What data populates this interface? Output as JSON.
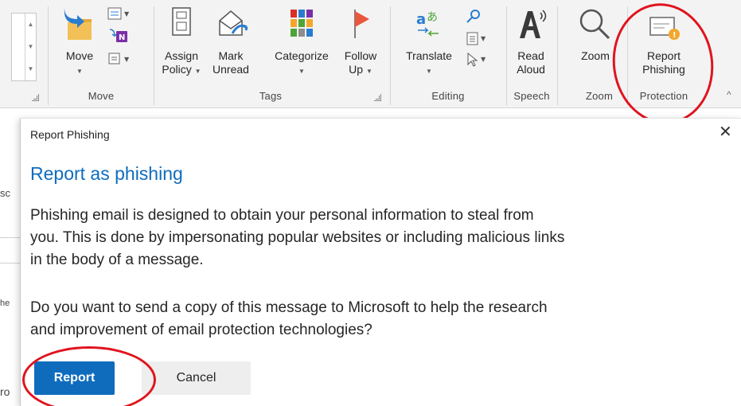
{
  "ribbon": {
    "move_group": {
      "move_label": "Move",
      "group_label": "Move"
    },
    "tags_group": {
      "assign_policy_line1": "Assign",
      "assign_policy_line2": "Policy",
      "mark_unread_line1": "Mark",
      "mark_unread_line2": "Unread",
      "categorize_label": "Categorize",
      "follow_up_line1": "Follow",
      "follow_up_line2": "Up",
      "group_label": "Tags"
    },
    "editing_group": {
      "translate_label": "Translate",
      "group_label": "Editing"
    },
    "speech_group": {
      "read_aloud_line1": "Read",
      "read_aloud_line2": "Aloud",
      "group_label": "Speech"
    },
    "zoom_group": {
      "zoom_label": "Zoom",
      "group_label": "Zoom"
    },
    "protection_group": {
      "report_phishing_line1": "Report",
      "report_phishing_line2": "Phishing",
      "group_label": "Protection"
    }
  },
  "background": {
    "frag1": "sc",
    "frag2": "he",
    "frag3": "ro"
  },
  "dialog": {
    "title": "Report Phishing",
    "close_glyph": "✕",
    "heading": "Report as phishing",
    "body_paragraph1_line1": "Phishing email is designed to obtain your personal information to steal from",
    "body_paragraph1_line2": "you. This is done by impersonating popular websites or including malicious links",
    "body_paragraph1_line3": "in the body of a message.",
    "body_paragraph2_line1": "Do you want to send a copy of this message to Microsoft to help the research",
    "body_paragraph2_line2": "and improvement of email protection technologies?",
    "report_button": "Report",
    "cancel_button": "Cancel"
  },
  "colors": {
    "accent_blue": "#0f6cbd",
    "callout_red": "#e0141e",
    "ribbon_bg": "#f3f3f3"
  }
}
